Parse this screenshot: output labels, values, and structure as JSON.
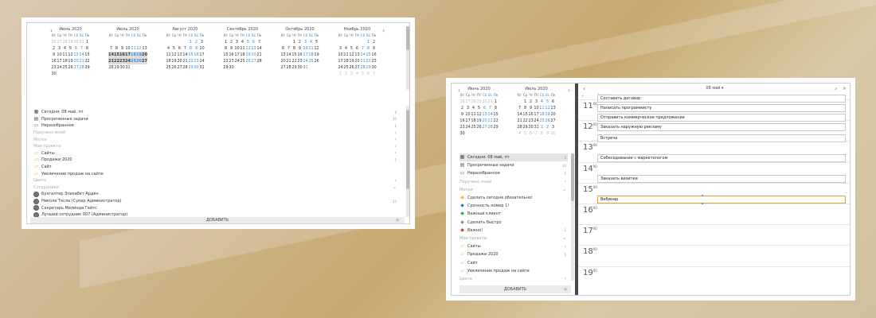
{
  "window1": {
    "months": [
      {
        "title": "Июнь 2020",
        "weeks": [
          [
            "26",
            "27",
            "28",
            "29",
            "30",
            "31",
            "1"
          ],
          [
            "2",
            "3",
            "4",
            "5",
            "6",
            "7",
            "8"
          ],
          [
            "9",
            "10",
            "11",
            "12",
            "13",
            "14",
            "15"
          ],
          [
            "16",
            "17",
            "18",
            "19",
            "20",
            "21",
            "22"
          ],
          [
            "23",
            "24",
            "25",
            "26",
            "27",
            "28",
            "29"
          ],
          [
            "30",
            "",
            "",
            "",
            "",
            "",
            ""
          ]
        ]
      },
      {
        "title": "Июль 2020",
        "weeks": [
          [
            "",
            "",
            "",
            "",
            "",
            "",
            ""
          ],
          [
            "7",
            "8",
            "9",
            "10",
            "11",
            "12",
            "13"
          ],
          [
            "14",
            "15",
            "16",
            "17",
            "18",
            "19",
            "20"
          ],
          [
            "21",
            "22",
            "23",
            "24",
            "25",
            "26",
            "27"
          ],
          [
            "28",
            "29",
            "30",
            "31",
            "",
            "",
            ""
          ],
          [
            "",
            "",
            "",
            "",
            "",
            "",
            ""
          ]
        ]
      },
      {
        "title": "Август 2020",
        "weeks": [
          [
            "",
            "",
            "",
            "",
            "1",
            "2",
            "3"
          ],
          [
            "4",
            "5",
            "6",
            "7",
            "8",
            "9",
            "10"
          ],
          [
            "11",
            "12",
            "13",
            "14",
            "15",
            "16",
            "17"
          ],
          [
            "18",
            "19",
            "20",
            "21",
            "22",
            "23",
            "24"
          ],
          [
            "25",
            "26",
            "27",
            "28",
            "29",
            "30",
            "31"
          ],
          [
            "",
            "",
            "",
            "",
            "",
            "",
            ""
          ]
        ]
      },
      {
        "title": "Сентябрь 2020",
        "weeks": [
          [
            "1",
            "2",
            "3",
            "4",
            "5",
            "6",
            "7"
          ],
          [
            "8",
            "9",
            "10",
            "11",
            "12",
            "13",
            "14"
          ],
          [
            "15",
            "16",
            "17",
            "18",
            "19",
            "20",
            "21"
          ],
          [
            "22",
            "23",
            "24",
            "25",
            "26",
            "27",
            "28"
          ],
          [
            "29",
            "30",
            "",
            "",
            "",
            "",
            ""
          ],
          [
            "",
            "",
            "",
            "",
            "",
            "",
            ""
          ]
        ]
      },
      {
        "title": "Октябрь 2020",
        "weeks": [
          [
            "",
            "",
            "1",
            "2",
            "3",
            "4",
            "5"
          ],
          [
            "6",
            "7",
            "8",
            "9",
            "10",
            "11",
            "12"
          ],
          [
            "13",
            "14",
            "15",
            "16",
            "17",
            "18",
            "19"
          ],
          [
            "20",
            "21",
            "22",
            "23",
            "24",
            "25",
            "26"
          ],
          [
            "27",
            "28",
            "29",
            "30",
            "31",
            "",
            ""
          ],
          [
            "",
            "",
            "",
            "",
            "",
            "",
            ""
          ]
        ]
      },
      {
        "title": "Ноябрь 2020",
        "weeks": [
          [
            "",
            "",
            "",
            "",
            "",
            "1",
            "2"
          ],
          [
            "3",
            "4",
            "5",
            "6",
            "7",
            "8",
            "9"
          ],
          [
            "10",
            "11",
            "12",
            "13",
            "14",
            "15",
            "16"
          ],
          [
            "17",
            "18",
            "19",
            "20",
            "21",
            "22",
            "23"
          ],
          [
            "24",
            "25",
            "26",
            "27",
            "28",
            "29",
            "30"
          ],
          [
            "1",
            "2",
            "3",
            "4",
            "5",
            "6",
            "7"
          ]
        ]
      }
    ],
    "dow": [
      "Вт",
      "Ср",
      "Чт",
      "Пт",
      "Сб",
      "Вс",
      "Пн"
    ],
    "items": [
      {
        "label": "Сегодня: 08 май, пт",
        "icon": "calendar-icon",
        "count": "8",
        "type": "item"
      },
      {
        "label": "Просроченные задачи",
        "icon": "overdue-icon",
        "count": "30",
        "type": "item"
      },
      {
        "label": "Неразобранное",
        "icon": "inbox-icon",
        "count": "1",
        "type": "item"
      },
      {
        "label": "Поручено мной",
        "type": "section",
        "chev": "‹"
      },
      {
        "label": "Метки",
        "type": "section",
        "chev": "‹"
      },
      {
        "label": "Мои проекты",
        "type": "section",
        "chev": "‹"
      },
      {
        "label": "Сайты",
        "icon": "folder-icon",
        "type": "item",
        "chev": "‹"
      },
      {
        "label": "Продажи 2020",
        "icon": "folder-icon",
        "count": "5",
        "type": "item"
      },
      {
        "label": "Сайт",
        "icon": "folder-icon",
        "type": "item"
      },
      {
        "label": "Увеличение продаж на сайте",
        "icon": "folder-icon",
        "type": "item"
      },
      {
        "label": "Цвета",
        "type": "section",
        "chev": "‹"
      },
      {
        "label": "Сотрудники",
        "type": "section",
        "chev": "⌄"
      },
      {
        "label": "Бухгалтер Элизабет Арден",
        "icon": "avatar",
        "type": "item"
      },
      {
        "label": "Никола Тесла (Супер Администратор)",
        "icon": "avatar",
        "count": "33",
        "type": "item"
      },
      {
        "label": "Секретарь Мелинда Гейтс",
        "icon": "avatar",
        "type": "item"
      },
      {
        "label": "Лучший сотрудник 007 (Администратор)",
        "icon": "avatar",
        "type": "item"
      }
    ],
    "add_label": "ДОБАВИТЬ"
  },
  "window2": {
    "months": [
      {
        "title": "Июнь 2020",
        "weeks": [
          [
            "26",
            "27",
            "28",
            "29",
            "30",
            "31",
            "1"
          ],
          [
            "2",
            "3",
            "4",
            "5",
            "6",
            "7",
            "8"
          ],
          [
            "9",
            "10",
            "11",
            "12",
            "13",
            "14",
            "15"
          ],
          [
            "16",
            "17",
            "18",
            "19",
            "20",
            "21",
            "22"
          ],
          [
            "23",
            "24",
            "25",
            "26",
            "27",
            "28",
            "29"
          ],
          [
            "30",
            "",
            "",
            "",
            "",
            "",
            ""
          ]
        ]
      },
      {
        "title": "Июль 2020",
        "weeks": [
          [
            "",
            "1",
            "2",
            "3",
            "4",
            "5",
            "6"
          ],
          [
            "7",
            "8",
            "9",
            "10",
            "11",
            "12",
            "13"
          ],
          [
            "14",
            "15",
            "16",
            "17",
            "18",
            "19",
            "20"
          ],
          [
            "21",
            "22",
            "23",
            "24",
            "25",
            "26",
            "27"
          ],
          [
            "28",
            "29",
            "30",
            "31",
            "1",
            "2",
            "3"
          ],
          [
            "4",
            "5",
            "6",
            "7",
            "8",
            "9",
            "10"
          ]
        ]
      }
    ],
    "dow": [
      "Вт",
      "Ср",
      "Чт",
      "Пт",
      "Сб",
      "Вс",
      "Пн"
    ],
    "items": [
      {
        "label": "Сегодня: 08 май, пт",
        "icon": "calendar-icon",
        "count": "8",
        "type": "item",
        "selected": true
      },
      {
        "label": "Просроченные задачи",
        "icon": "overdue-icon",
        "count": "30",
        "type": "item"
      },
      {
        "label": "Неразобранное",
        "icon": "inbox-icon",
        "count": "1",
        "type": "item"
      },
      {
        "label": "Поручено мной",
        "type": "section",
        "chev": "‹"
      },
      {
        "label": "Метки",
        "type": "section",
        "chev": "⌄"
      },
      {
        "label": "Сделать сегодня обязательно!",
        "icon": "tag-icon",
        "color": "#f2c21b",
        "type": "item"
      },
      {
        "label": "Срочность номер 1!",
        "icon": "tag-icon",
        "color": "#2d6fd8",
        "type": "item"
      },
      {
        "label": "Важный клиент",
        "icon": "tag-icon",
        "color": "#34a853",
        "type": "item"
      },
      {
        "label": "Сделать быстро",
        "icon": "tag-icon",
        "color": "#8e8e8e",
        "type": "item"
      },
      {
        "label": "Важно!",
        "icon": "tag-icon",
        "color": "#d93025",
        "count": "1",
        "type": "item"
      },
      {
        "label": "Мои проекты",
        "type": "section",
        "chev": "⌄"
      },
      {
        "label": "Сайты",
        "icon": "folder-icon",
        "type": "item",
        "chev": "‹"
      },
      {
        "label": "Продажи 2020",
        "icon": "folder-icon",
        "count": "5",
        "type": "item"
      },
      {
        "label": "Сайт",
        "icon": "folder-icon",
        "type": "item"
      },
      {
        "label": "Увеличение продаж на сайте",
        "icon": "folder-icon",
        "type": "item"
      },
      {
        "label": "Цвета",
        "type": "section",
        "chev": "‹"
      }
    ],
    "add_label": "ДОБАВИТЬ",
    "day_title": "08 май ▾",
    "note_label": "Заметки",
    "hours": [
      {
        "h": "11",
        "m": "00"
      },
      {
        "h": "12",
        "m": "00"
      },
      {
        "h": "13",
        "m": "00"
      },
      {
        "h": "14",
        "m": "00"
      },
      {
        "h": "15",
        "m": "00"
      },
      {
        "h": "16",
        "m": "00"
      },
      {
        "h": "17",
        "m": "00"
      },
      {
        "h": "18",
        "m": "00"
      },
      {
        "h": "19",
        "m": "00"
      }
    ],
    "events": [
      {
        "title": "Составить договор"
      },
      {
        "title": "Написать программисту"
      },
      {
        "title": "Отправить коммерческое предложение"
      },
      {
        "title": "Заказать наружную рекламу"
      },
      {
        "title": "Встреча"
      },
      {
        "title": "Собеседование с маркетологом"
      },
      {
        "title": "Заказать визитки"
      },
      {
        "title": "Вебинар"
      }
    ]
  },
  "colors": {
    "weekend": "#3a8fd6",
    "accent": "#e8a23a",
    "divider": "#4a4a4a"
  }
}
